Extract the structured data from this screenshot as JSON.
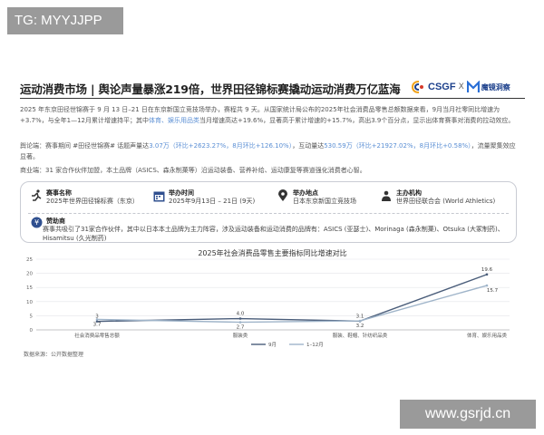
{
  "watermarks": {
    "top": "TG: MYYJJPP",
    "bottom": "www.gsrjd.cn"
  },
  "header": {
    "title": "运动消费市场 | 舆论声量暴涨219倍，世界田径锦标赛撬动运动消费万亿蓝海",
    "logo_csgf": "CSGF",
    "logo_sep": "X",
    "logo_mj": "魔镜洞察"
  },
  "paragraphs": {
    "p1_part1": "2025 年东京田径世锦赛于 9 月 13 日–21 日在东京新国立竞技场举办，赛程共 9 天。从国家统计局公布的2025年社会消费品零售总额数据来看，9月当月社零同比增速为+3.7%，与全年1—12月累计增速持平；其中",
    "p1_highlight": "体育、娱乐用品类",
    "p1_part2": "当月增速高达+19.6%，显著高于累计增速的+15.7%，高出3.9个百分点，显示出体育赛事对消费的拉动效应。",
    "p2_part1": "舆论端：赛事期间 #田径世锦赛# 话题声量达",
    "p2_hl1": "3.07万（环比+2623.27%，8月环比+126.10%）",
    "p2_part2": "，互动量达",
    "p2_hl2": "530.59万（环比+21927.02%，8月环比+0.58%）",
    "p2_part3": "，流量聚集效应显著。",
    "p3": "商业端：31 家合作伙伴加盟，本土品牌（ASICS、森永制菓等）沿运动装备、营养补给、运动康复等赛道强化消费者心智。"
  },
  "event_card": {
    "name_label": "赛事名称",
    "name_value": "2025年世界田径锦标赛（东京）",
    "time_label": "举办时间",
    "time_value": "2025年9月13日 – 21日 (9天)",
    "place_label": "举办地点",
    "place_value": "日本东京新国立竞技场",
    "org_label": "主办机构",
    "org_value": "世界田径联合会 (World Athletics)",
    "sponsor_label": "赞助商",
    "sponsor_text": "赛事共吸引了31家合作伙伴，其中以日本本土品牌为主力阵容，涉及运动装备和运动消费的品牌有：ASICS (亚瑟士)、Morinaga (森永制菓)、Otsuka (大冢制药)、Hisamitsu (久光制药)"
  },
  "chart_data": {
    "type": "line",
    "title": "2025年社会消费品零售主要指标同比增速对比",
    "categories": [
      "社会消费品零售总额",
      "服装类",
      "服装、鞋帽、针纺织品类",
      "体育、娱乐用品类"
    ],
    "series": [
      {
        "name": "9月",
        "values": [
          3,
          4.0,
          3.1,
          19.6
        ],
        "color": "#4a5d7a"
      },
      {
        "name": "1–12月",
        "values": [
          3.7,
          2.7,
          3.2,
          15.7
        ],
        "color": "#9fb4c9"
      }
    ],
    "data_labels_series1": [
      "3",
      "4.0",
      "3.1",
      "19.6"
    ],
    "data_labels_series2": [
      "3.7",
      "2.7",
      "3.2",
      "15.7"
    ],
    "yticks": [
      "0",
      "5",
      "10",
      "15",
      "20",
      "25"
    ],
    "ylim": [
      0,
      25
    ],
    "grid": true,
    "legend_placement": "bottom"
  },
  "source": "数据来源：公开数据整理"
}
